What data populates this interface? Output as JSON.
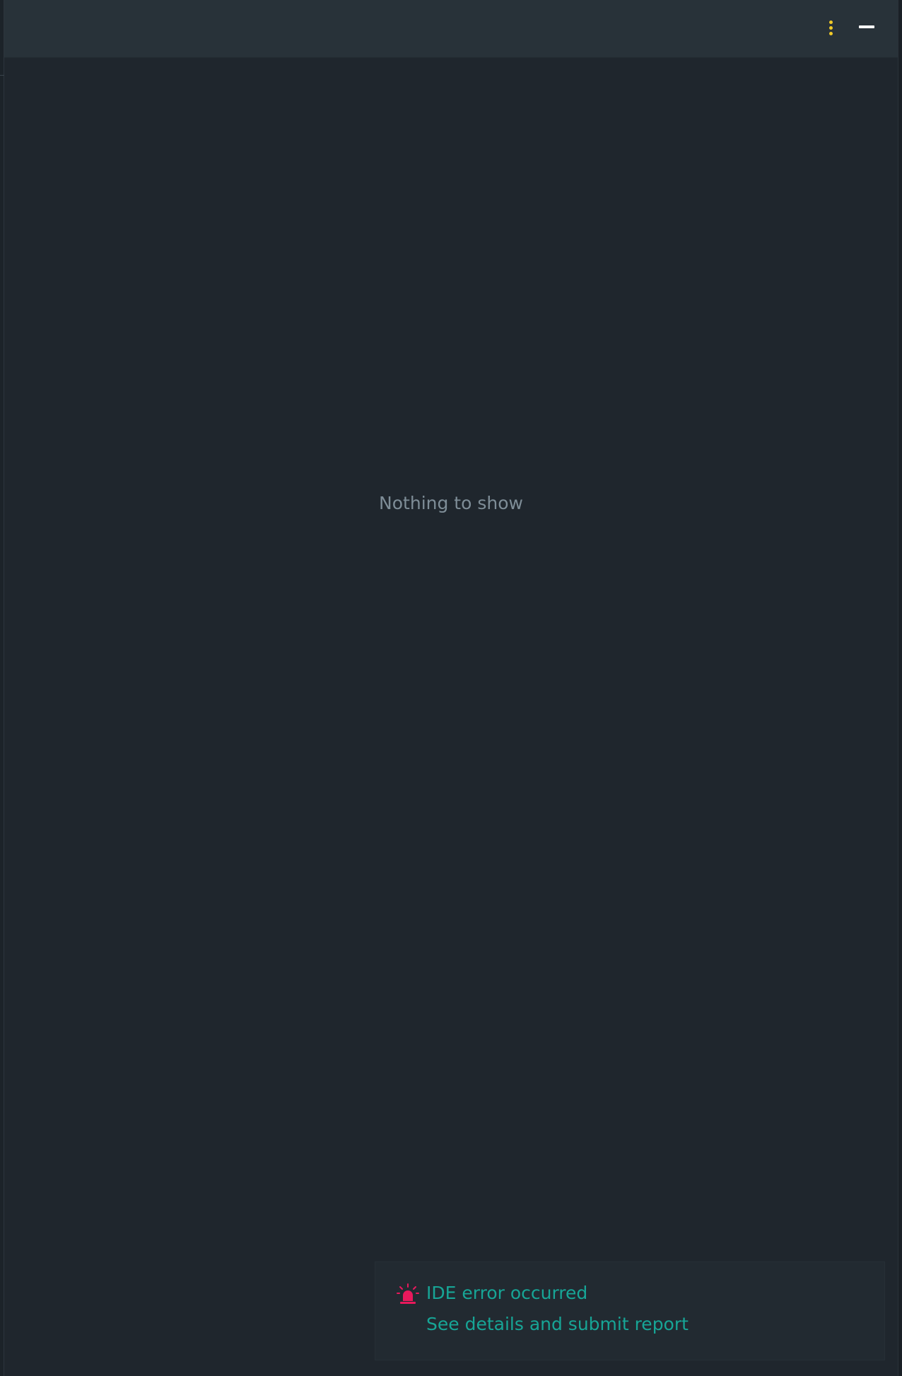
{
  "empty_state": {
    "text": "Nothing to show"
  },
  "header": {
    "options_icon": "more-vertical-icon",
    "minimize_icon": "minimize-icon"
  },
  "notification": {
    "icon": "alarm-siren-icon",
    "title": "IDE error occurred",
    "link_text": "See details and submit report"
  },
  "colors": {
    "background": "#1f262d",
    "header": "#283239",
    "accent_link": "#17a596",
    "error_icon": "#e8195c",
    "kebab": "#f0c928",
    "muted_text": "#7e8d97"
  }
}
